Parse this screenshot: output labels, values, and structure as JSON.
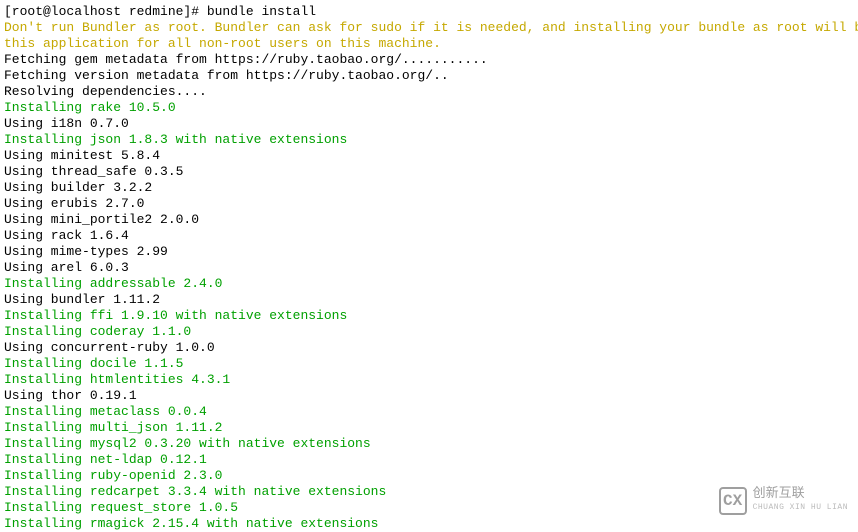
{
  "terminal": {
    "prompt": "[root@localhost redmine]# bundle install",
    "warning": "Don't run Bundler as root. Bundler can ask for sudo if it is needed, and installing your bundle as root will break\nthis application for all non-root users on this machine.",
    "lines": [
      {
        "text": "Fetching gem metadata from https://ruby.taobao.org/...........",
        "type": "info"
      },
      {
        "text": "Fetching version metadata from https://ruby.taobao.org/..",
        "type": "info"
      },
      {
        "text": "Resolving dependencies....",
        "type": "info"
      },
      {
        "text": "Installing rake 10.5.0",
        "type": "install"
      },
      {
        "text": "Using i18n 0.7.0",
        "type": "using"
      },
      {
        "text": "Installing json 1.8.3 with native extensions",
        "type": "install"
      },
      {
        "text": "Using minitest 5.8.4",
        "type": "using"
      },
      {
        "text": "Using thread_safe 0.3.5",
        "type": "using"
      },
      {
        "text": "Using builder 3.2.2",
        "type": "using"
      },
      {
        "text": "Using erubis 2.7.0",
        "type": "using"
      },
      {
        "text": "Using mini_portile2 2.0.0",
        "type": "using"
      },
      {
        "text": "Using rack 1.6.4",
        "type": "using"
      },
      {
        "text": "Using mime-types 2.99",
        "type": "using"
      },
      {
        "text": "Using arel 6.0.3",
        "type": "using"
      },
      {
        "text": "Installing addressable 2.4.0",
        "type": "install"
      },
      {
        "text": "Using bundler 1.11.2",
        "type": "using"
      },
      {
        "text": "Installing ffi 1.9.10 with native extensions",
        "type": "install"
      },
      {
        "text": "Installing coderay 1.1.0",
        "type": "install"
      },
      {
        "text": "Using concurrent-ruby 1.0.0",
        "type": "using"
      },
      {
        "text": "Installing docile 1.1.5",
        "type": "install"
      },
      {
        "text": "Installing htmlentities 4.3.1",
        "type": "install"
      },
      {
        "text": "Using thor 0.19.1",
        "type": "using"
      },
      {
        "text": "Installing metaclass 0.0.4",
        "type": "install"
      },
      {
        "text": "Installing multi_json 1.11.2",
        "type": "install"
      },
      {
        "text": "Installing mysql2 0.3.20 with native extensions",
        "type": "install"
      },
      {
        "text": "Installing net-ldap 0.12.1",
        "type": "install"
      },
      {
        "text": "Installing ruby-openid 2.3.0",
        "type": "install"
      },
      {
        "text": "Installing redcarpet 3.3.4 with native extensions",
        "type": "install"
      },
      {
        "text": "Installing request_store 1.0.5",
        "type": "install"
      },
      {
        "text": "Installing rmagick 2.15.4 with native extensions",
        "type": "install"
      }
    ]
  },
  "watermark": {
    "logo": "CX",
    "label": "创新互联",
    "sublabel": "CHUANG XIN HU LIAN"
  }
}
